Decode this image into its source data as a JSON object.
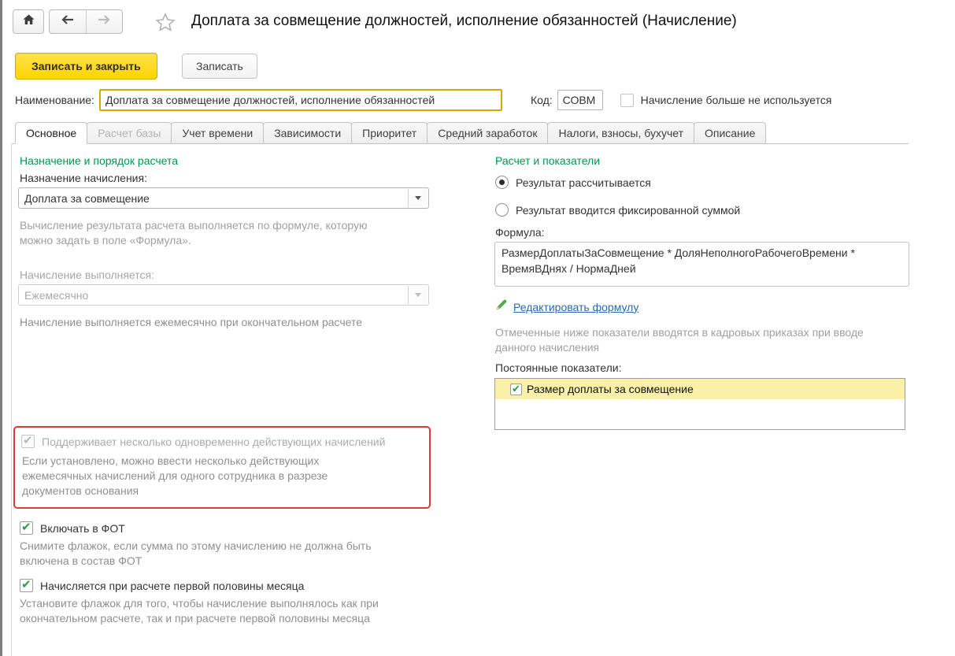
{
  "window": {
    "title": "Доплата за совмещение должностей, исполнение обязанностей (Начисление)"
  },
  "toolbar": {
    "save_close_label": "Записать и закрыть",
    "save_label": "Записать"
  },
  "header_fields": {
    "name_label": "Наименование:",
    "name_value": "Доплата за совмещение должностей, исполнение обязанностей",
    "code_label": "Код:",
    "code_value": "СОВМ",
    "not_used_label": "Начисление больше не используется",
    "not_used_checked": false
  },
  "tabs": [
    {
      "label": "Основное",
      "active": true,
      "disabled": false
    },
    {
      "label": "Расчет базы",
      "active": false,
      "disabled": true
    },
    {
      "label": "Учет времени",
      "active": false,
      "disabled": false
    },
    {
      "label": "Зависимости",
      "active": false,
      "disabled": false
    },
    {
      "label": "Приоритет",
      "active": false,
      "disabled": false
    },
    {
      "label": "Средний заработок",
      "active": false,
      "disabled": false
    },
    {
      "label": "Налоги, взносы, бухучет",
      "active": false,
      "disabled": false
    },
    {
      "label": "Описание",
      "active": false,
      "disabled": false
    }
  ],
  "left": {
    "section_title": "Назначение и порядок расчета",
    "purpose_label": "Назначение начисления:",
    "purpose_value": "Доплата за совмещение",
    "purpose_hint": "Вычисление результата расчета выполняется по формуле, которую можно задать в поле «Формула».",
    "schedule_label": "Начисление выполняется:",
    "schedule_value": "Ежемесячно",
    "schedule_disabled": true,
    "schedule_hint": "Начисление выполняется ежемесячно при окончательном расчете",
    "multi": {
      "label": "Поддерживает несколько одновременно действующих начислений",
      "checked": true,
      "disabled": true,
      "hint": "Если установлено, можно ввести несколько действующих ежемесячных начислений для одного сотрудника в разрезе документов основания"
    },
    "fot": {
      "label": "Включать в ФОТ",
      "checked": true,
      "hint": "Снимите флажок, если сумма по этому начислению не должна быть включена в состав ФОТ"
    },
    "half_month": {
      "label": "Начисляется при расчете первой половины месяца",
      "checked": true,
      "hint": "Установите флажок для того, чтобы начисление выполнялось как при окончательном расчете, так и при расчете первой половины месяца"
    }
  },
  "right": {
    "section_title": "Расчет и показатели",
    "radio_calculated": "Результат рассчитывается",
    "radio_calculated_selected": true,
    "radio_fixed": "Результат вводится фиксированной суммой",
    "radio_fixed_selected": false,
    "formula_label": "Формула:",
    "formula_value": "РазмерДоплатыЗаСовмещение * ДоляНеполногоРабочегоВремени * ВремяВДнях / НормаДней",
    "edit_formula_link": "Редактировать формулу",
    "indicators_hint": "Отмеченные ниже показатели вводятся в кадровых приказах при вводе данного начисления",
    "indicators_label": "Постоянные показатели:",
    "indicators": [
      {
        "label": "Размер доплаты за совмещение",
        "checked": true
      }
    ]
  },
  "colors": {
    "accent_yellow": "#fcd500",
    "focus_border": "#dca700",
    "section_green": "#00994d",
    "check_green": "#2e9d42",
    "link_blue": "#2969b0",
    "attention_red": "#df3a2f",
    "selected_row_yellow": "#fbf0a7"
  }
}
